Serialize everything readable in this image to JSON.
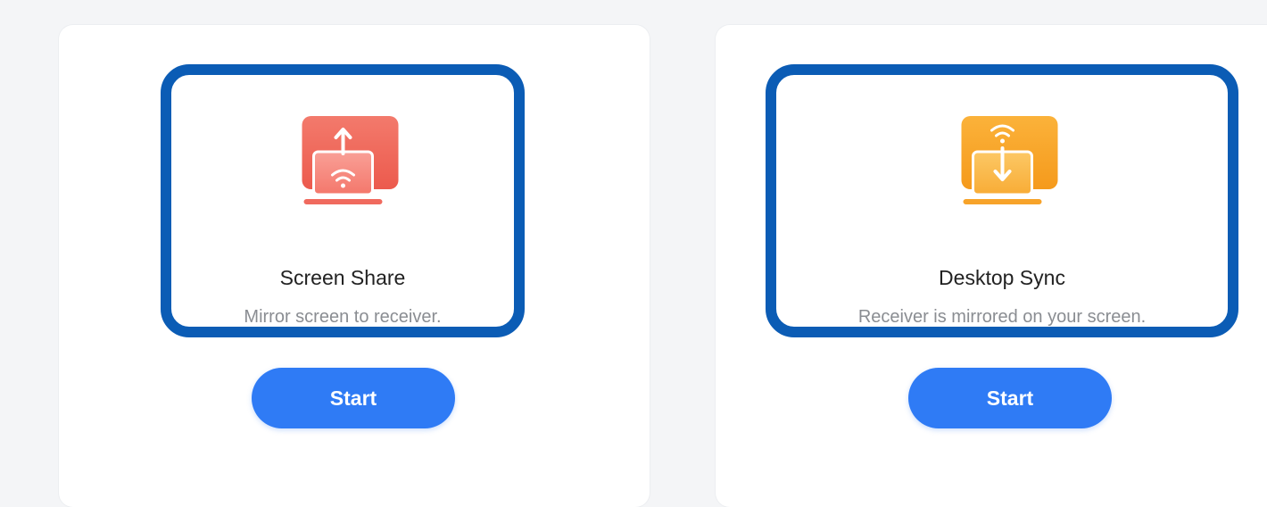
{
  "cards": [
    {
      "title": "Screen Share",
      "subtitle": "Mirror screen to receiver.",
      "button_label": "Start",
      "icon": "screen-share-icon",
      "icon_color": "#f2685c"
    },
    {
      "title": "Desktop Sync",
      "subtitle": "Receiver is mirrored on your screen.",
      "button_label": "Start",
      "icon": "desktop-sync-icon",
      "icon_color": "#f7a325"
    }
  ],
  "colors": {
    "highlight_border": "#0b5cb5",
    "button": "#2f7bf5"
  }
}
